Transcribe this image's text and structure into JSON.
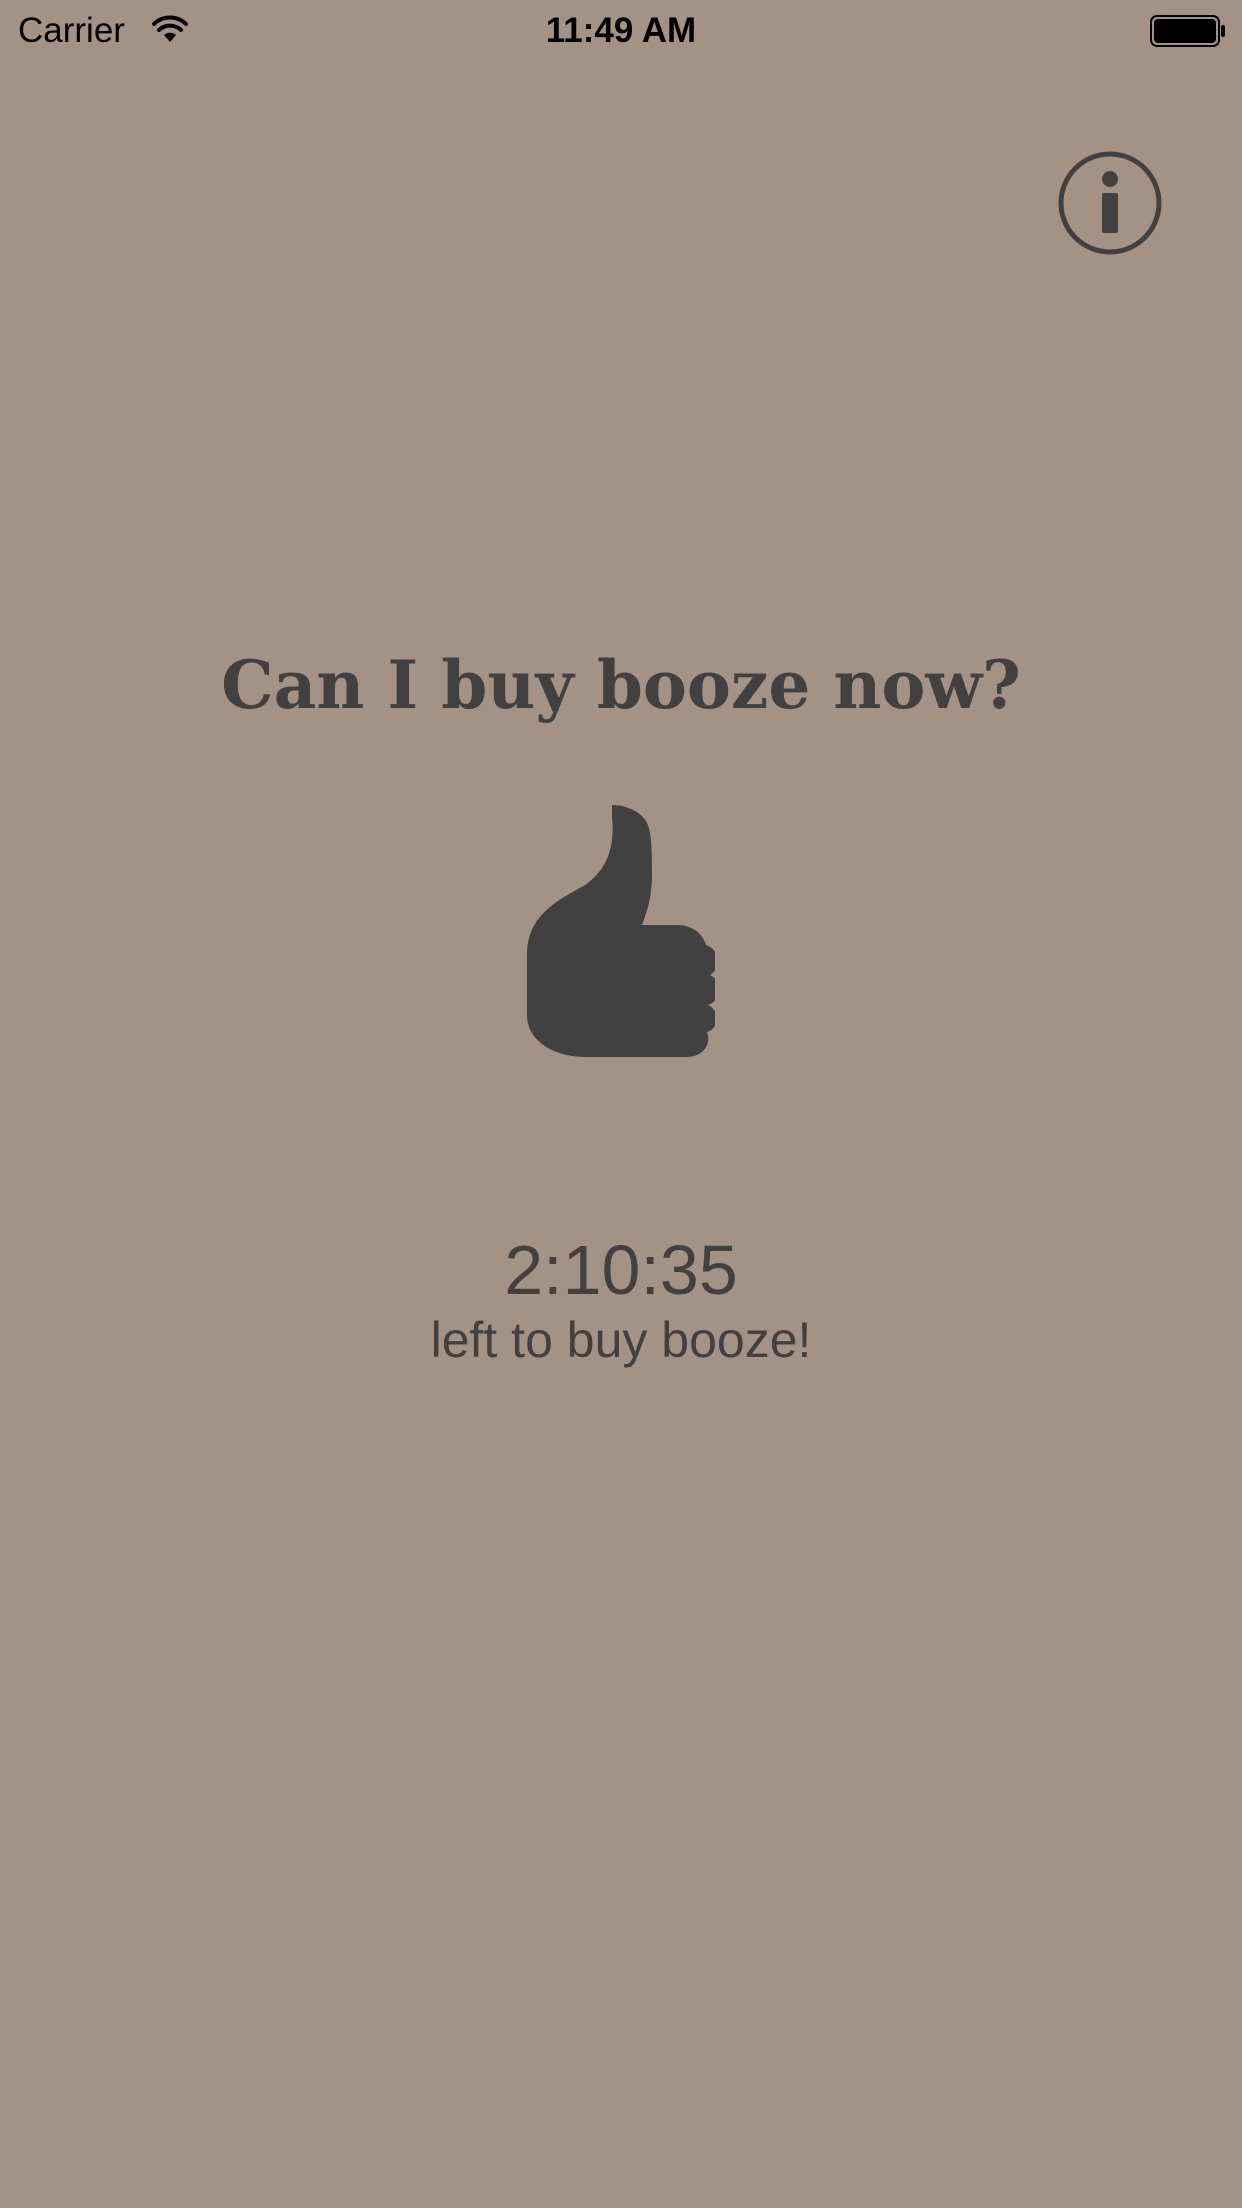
{
  "status_bar": {
    "carrier": "Carrier",
    "time": "11:49 AM",
    "icons": [
      "wifi-icon",
      "battery-icon"
    ]
  },
  "info_button": {
    "icon": "info-icon"
  },
  "main": {
    "question": "Can I buy booze now?",
    "answer_icon": "thumbs-up-icon",
    "countdown": "2:10:35",
    "caption": "left to buy booze!"
  },
  "colors": {
    "background": "#a49385",
    "foreground": "#414141",
    "status_text": "#000000"
  }
}
